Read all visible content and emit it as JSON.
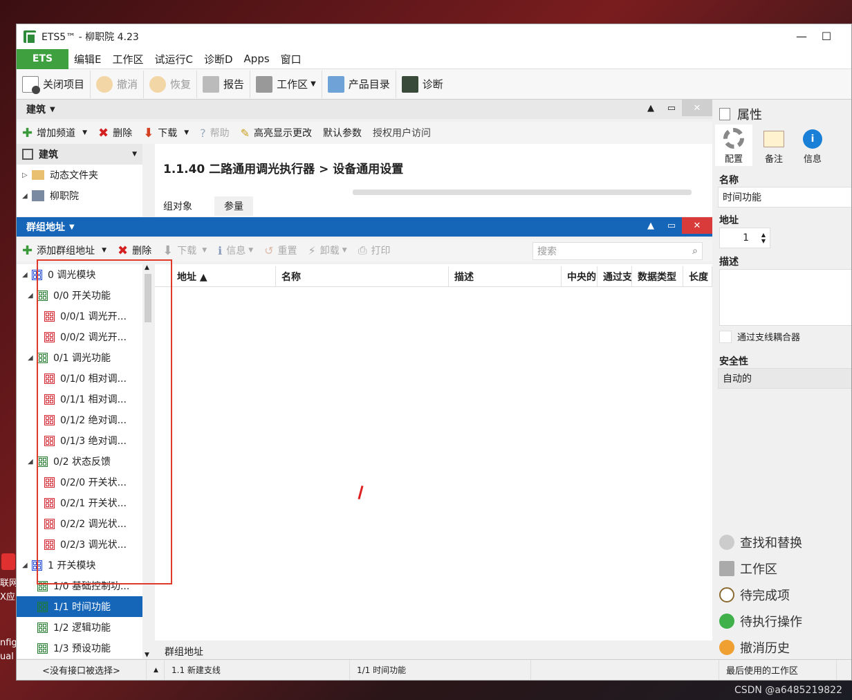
{
  "window": {
    "title": "ETS5™ - 柳职院 4.23"
  },
  "menu": {
    "ets": "ETS",
    "items": [
      "编辑E",
      "工作区",
      "试运行C",
      "诊断D",
      "Apps",
      "窗口"
    ]
  },
  "toolbar": {
    "close_project": "关闭项目",
    "undo": "撤消",
    "redo": "恢复",
    "report": "报告",
    "workspace": "工作区",
    "product_catalog": "产品目录",
    "diagnostics": "诊断"
  },
  "building_panel": {
    "header": "建筑",
    "actions": {
      "add_channel": "增加频道",
      "delete": "删除",
      "download": "下载",
      "help": "帮助",
      "highlight": "高亮显示更改",
      "default_params": "默认参数",
      "auth_access": "授权用户访问"
    },
    "tree": {
      "root": "建筑",
      "dynamic_folder": "动态文件夹",
      "project": "柳职院"
    },
    "device_title": "1.1.40 二路通用调光执行器 > 设备通用设置",
    "tabs": [
      "组对象",
      "参量"
    ]
  },
  "group_panel": {
    "header": "群组地址",
    "actions": {
      "add_group": "添加群组地址",
      "delete": "删除",
      "download": "下载",
      "info": "信息",
      "reset": "重置",
      "unload": "卸载",
      "print": "打印"
    },
    "search_placeholder": "搜索",
    "tree": [
      {
        "level": 0,
        "kind": "blue",
        "label": "0 调光模块",
        "arrow": "◢"
      },
      {
        "level": 1,
        "kind": "green",
        "label": "0/0 开关功能",
        "arrow": "◢"
      },
      {
        "level": 2,
        "kind": "red",
        "label": "0/0/1 调光开..."
      },
      {
        "level": 2,
        "kind": "red",
        "label": "0/0/2 调光开..."
      },
      {
        "level": 1,
        "kind": "green",
        "label": "0/1 调光功能",
        "arrow": "◢"
      },
      {
        "level": 2,
        "kind": "red",
        "label": "0/1/0 相对调..."
      },
      {
        "level": 2,
        "kind": "red",
        "label": "0/1/1 相对调..."
      },
      {
        "level": 2,
        "kind": "red",
        "label": "0/1/2 绝对调..."
      },
      {
        "level": 2,
        "kind": "red",
        "label": "0/1/3 绝对调..."
      },
      {
        "level": 1,
        "kind": "green",
        "label": "0/2 状态反馈",
        "arrow": "◢"
      },
      {
        "level": 2,
        "kind": "red",
        "label": "0/2/0 开关状..."
      },
      {
        "level": 2,
        "kind": "red",
        "label": "0/2/1 开关状..."
      },
      {
        "level": 2,
        "kind": "red",
        "label": "0/2/2 调光状..."
      },
      {
        "level": 2,
        "kind": "red",
        "label": "0/2/3 调光状..."
      },
      {
        "level": 0,
        "kind": "blue",
        "label": "1 开关模块",
        "arrow": "◢"
      },
      {
        "level": 1,
        "kind": "green",
        "label": "1/0 基础控制功..."
      },
      {
        "level": 1,
        "kind": "green",
        "label": "1/1 时间功能",
        "selected": true
      },
      {
        "level": 1,
        "kind": "green",
        "label": "1/2 逻辑功能"
      },
      {
        "level": 1,
        "kind": "green",
        "label": "1/3 预设功能"
      }
    ],
    "columns": [
      "地址 ▲",
      "名称",
      "描述",
      "中央的",
      "通过支",
      "数据类型",
      "长度"
    ],
    "bottom_tab": "群组地址"
  },
  "properties": {
    "header": "属性",
    "tabs": [
      "配置",
      "备注",
      "信息"
    ],
    "name_label": "名称",
    "name_value": "时间功能",
    "address_label": "地址",
    "address_value": "1",
    "desc_label": "描述",
    "coupler_label": "通过支线耦合器",
    "security_label": "安全性",
    "security_value": "自动的"
  },
  "side_links": [
    "查找和替换",
    "工作区",
    "待完成项",
    "待执行操作",
    "撤消历史"
  ],
  "statusbar": {
    "interface": "<没有接口被选择>",
    "line": "1.1 新建支线",
    "selection": "1/1 时间功能",
    "last_workspace": "最后使用的工作区"
  },
  "watermark": "CSDN @a6485219822",
  "desktop_fragments": [
    "联网",
    "X应",
    "nfig",
    "ual"
  ]
}
